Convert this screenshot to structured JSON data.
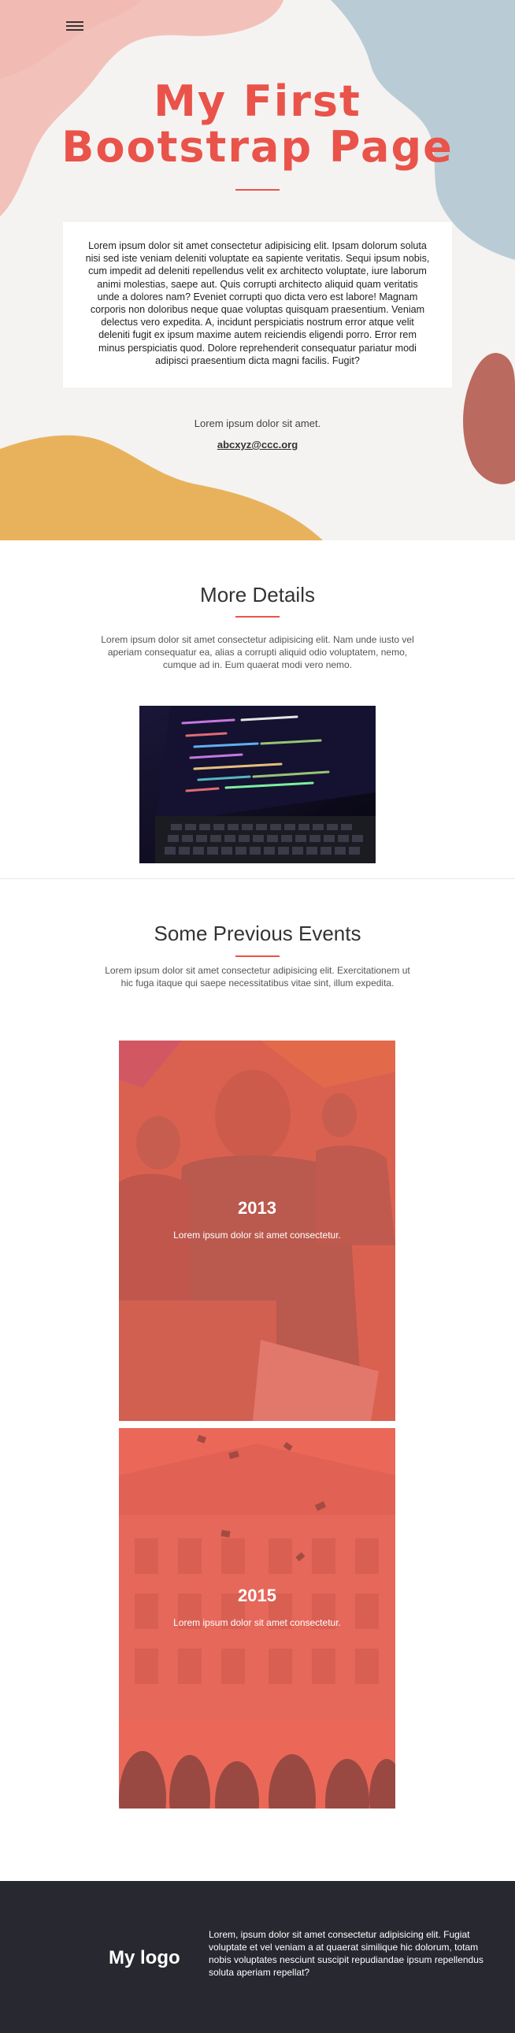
{
  "hero": {
    "title_line1": "My First",
    "title_line2": "Bootstrap Page",
    "paragraph": "Lorem ipsum dolor sit amet consectetur adipisicing elit. Ipsam dolorum soluta nisi sed iste veniam deleniti voluptate ea sapiente veritatis. Sequi ipsum nobis, cum impedit ad deleniti repellendus velit ex architecto voluptate, iure laborum animi molestias, saepe aut. Quis corrupti architecto aliquid quam veritatis unde a dolores nam? Eveniet corrupti quo dicta vero est labore! Magnam corporis non doloribus neque quae voluptas quisquam praesentium. Veniam delectus vero expedita. A, incidunt perspiciatis nostrum error atque velit deleniti fugit ex ipsum maxime autem reiciendis eligendi porro. Error rem minus perspiciatis quod. Dolore reprehenderit consequatur pariatur modi adipisci praesentium dicta magni facilis. Fugit?",
    "subtitle": "Lorem ipsum dolor sit amet.",
    "email": "abcxyz@ccc.org"
  },
  "details": {
    "title": "More Details",
    "text": "Lorem ipsum dolor sit amet consectetur adipisicing elit. Nam unde iusto vel aperiam consequatur ea, alias a corrupti aliquid odio voluptatem, nemo, cumque ad in. Eum quaerat modi vero nemo."
  },
  "events": {
    "title": "Some Previous Events",
    "text": "Lorem ipsum dolor sit amet consectetur adipisicing elit. Exercitationem ut hic fuga itaque qui saepe necessitatibus vitae sint, illum expedita.",
    "items": [
      {
        "year": "2013",
        "caption": "Lorem ipsum dolor sit amet consectetur."
      },
      {
        "year": "2015",
        "caption": "Lorem ipsum dolor sit amet consectetur."
      }
    ]
  },
  "footer": {
    "logo": "My logo",
    "text": "Lorem, ipsum dolor sit amet consectetur adipisicing elit. Fugiat voluptate et vel veniam a at quaerat similique hic dolorum, totam nobis voluptates nesciunt suscipit repudiandae ipsum repellendus soluta aperiam repellat?"
  },
  "colors": {
    "accent": "#e9534a",
    "footer_bg": "#272830",
    "blob_pink": "#f2c2ba",
    "blob_blue": "#b9ccd6",
    "blob_yellow": "#e8b25d",
    "blob_brown": "#bb6a60"
  },
  "icons": {
    "menu": "hamburger-icon"
  }
}
